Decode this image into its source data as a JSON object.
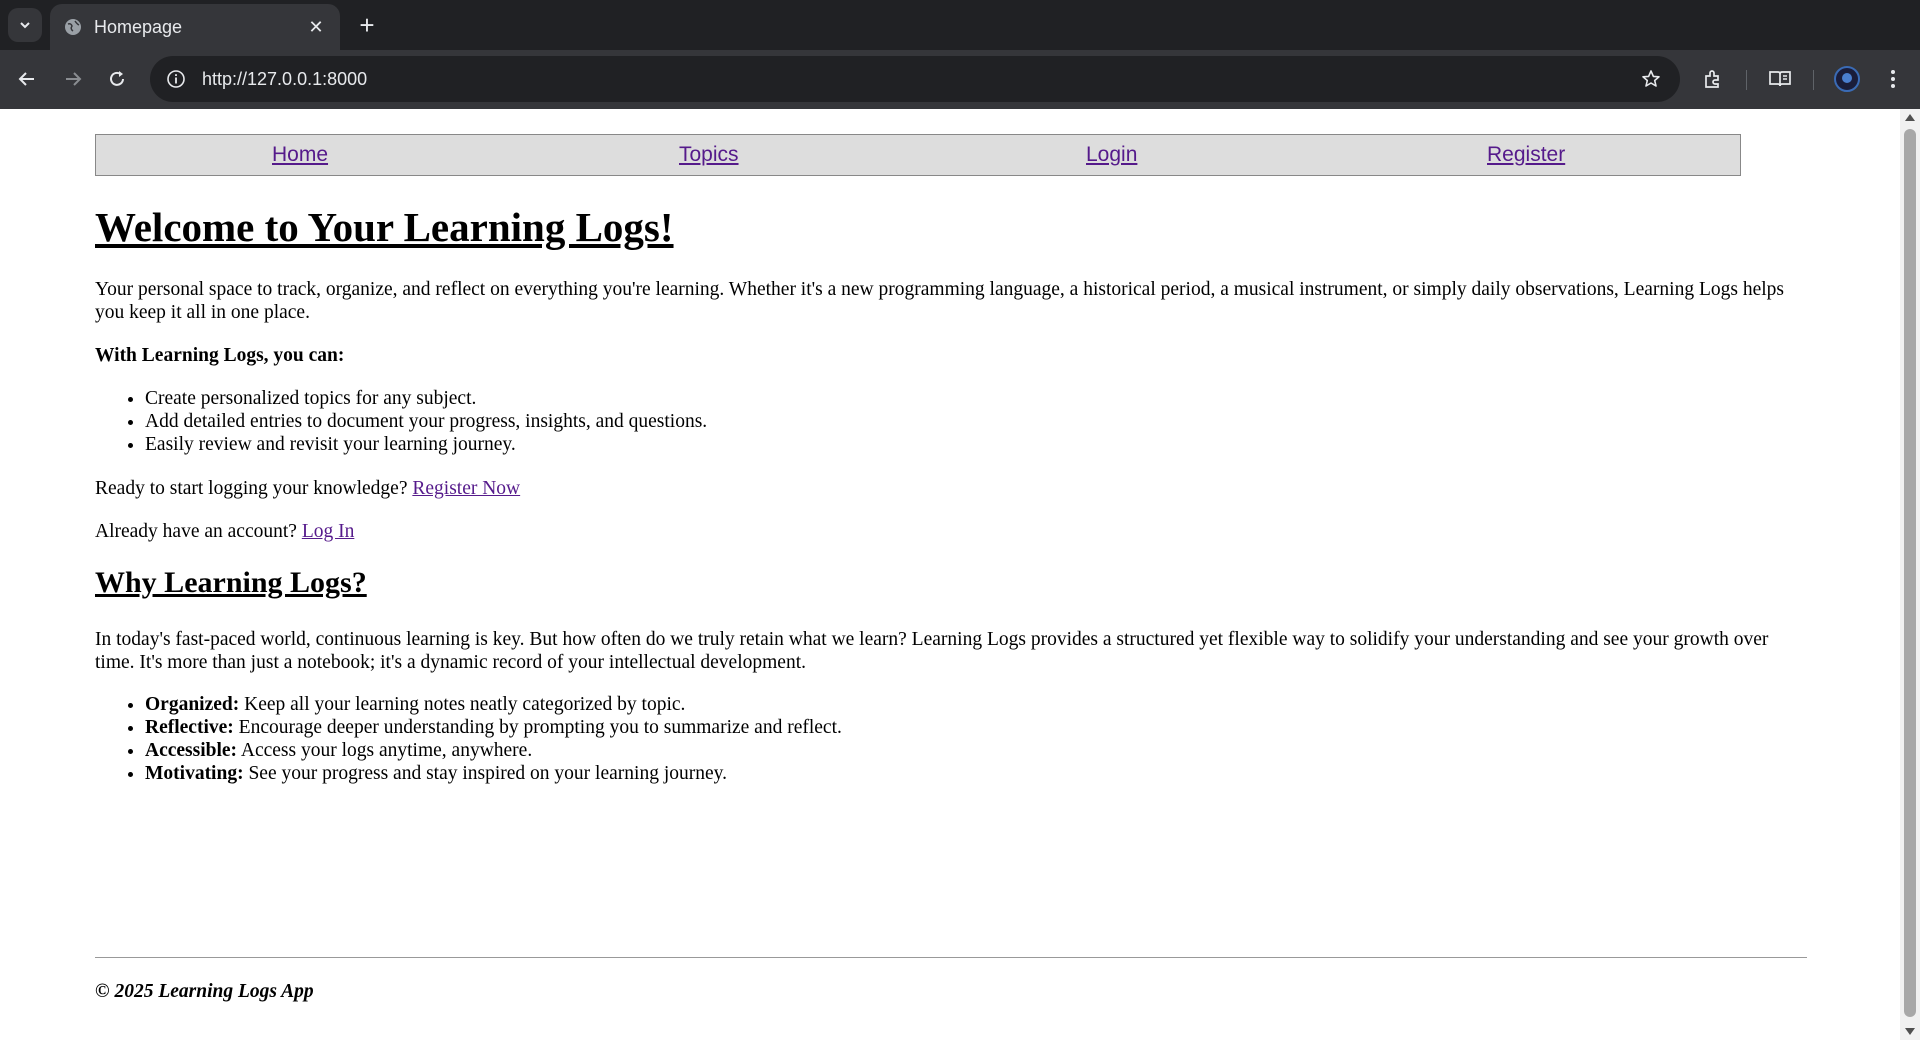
{
  "browser": {
    "tab_title": "Homepage",
    "url": "http://127.0.0.1:8000"
  },
  "nav": {
    "home": "Home",
    "topics": "Topics",
    "login": "Login",
    "register": "Register"
  },
  "hero": {
    "title": "Welcome to Your Learning Logs!",
    "intro": "Your personal space to track, organize, and reflect on everything you're learning. Whether it's a new programming language, a historical period, a musical instrument, or simply daily observations, Learning Logs helps you keep it all in one place.",
    "can_heading": "With Learning Logs, you can:",
    "features": [
      "Create personalized topics for any subject.",
      "Add detailed entries to document your progress, insights, and questions.",
      "Easily review and revisit your learning journey."
    ],
    "register_prompt": "Ready to start logging your knowledge?",
    "register_link": "Register Now",
    "login_prompt": "Already have an account?",
    "login_link": "Log In"
  },
  "why": {
    "title": "Why Learning Logs?",
    "paragraph": "In today's fast-paced world, continuous learning is key. But how often do we truly retain what we learn? Learning Logs provides a structured yet flexible way to solidify your understanding and see your growth over time. It's more than just a notebook; it's a dynamic record of your intellectual development.",
    "benefits": [
      {
        "term": "Organized:",
        "text": "Keep all your learning notes neatly categorized by topic."
      },
      {
        "term": "Reflective:",
        "text": "Encourage deeper understanding by prompting you to summarize and reflect."
      },
      {
        "term": "Accessible:",
        "text": "Access your logs anytime, anywhere."
      },
      {
        "term": "Motivating:",
        "text": "See your progress and stay inspired on your learning journey."
      }
    ]
  },
  "footer": {
    "text": "© 2025 Learning Logs App"
  }
}
